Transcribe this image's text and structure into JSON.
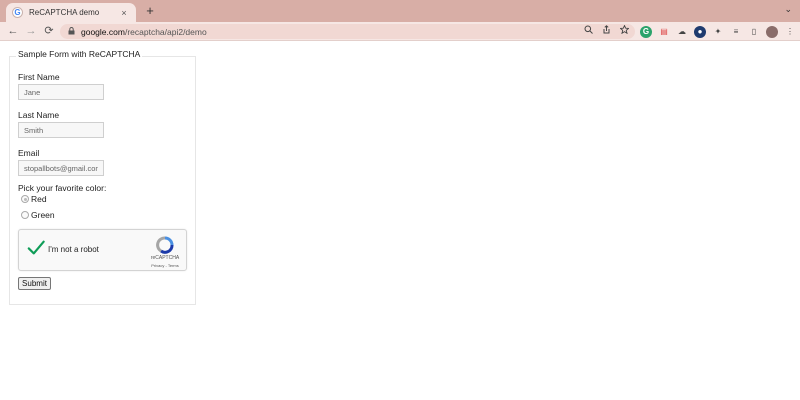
{
  "browser": {
    "tab_title": "ReCAPTCHA demo",
    "tab_favicon": "G",
    "tab_close": "×",
    "newtab": "+",
    "tab_menu": "⌄",
    "nav": {
      "back": "←",
      "forward": "→",
      "reload": "⟳"
    },
    "lock": "🔒",
    "url_host": "google.com",
    "url_path": "/recaptcha/api2/demo",
    "omnibox_icons": [
      "search-icon",
      "share-icon",
      "star-icon"
    ],
    "extensions": [
      "grammarly-extension-icon",
      "red-extension-icon",
      "cloud-extension-icon",
      "blue-extension-icon",
      "puzzle-icon",
      "media-icon",
      "sidepanel-icon",
      "profile-avatar",
      "menu-icon"
    ]
  },
  "form": {
    "legend": "Sample Form with ReCAPTCHA",
    "first_name_label": "First Name",
    "first_name_value": "Jane",
    "last_name_label": "Last Name",
    "last_name_value": "Smith",
    "email_label": "Email",
    "email_value": "stopallbots@gmail.com",
    "color_question": "Pick your favorite color:",
    "colors": [
      {
        "label": "Red",
        "checked": true
      },
      {
        "label": "Green",
        "checked": false
      }
    ],
    "submit_label": "Submit"
  },
  "captcha": {
    "text": "I'm not a robot",
    "brand": "reCAPTCHA",
    "links": "Privacy - Terms",
    "checked": true,
    "check_color": "#0f9d58"
  },
  "colors": {
    "chrome_tabbar": "#d8aea6",
    "chrome_toolbar": "#f6e7e4"
  }
}
